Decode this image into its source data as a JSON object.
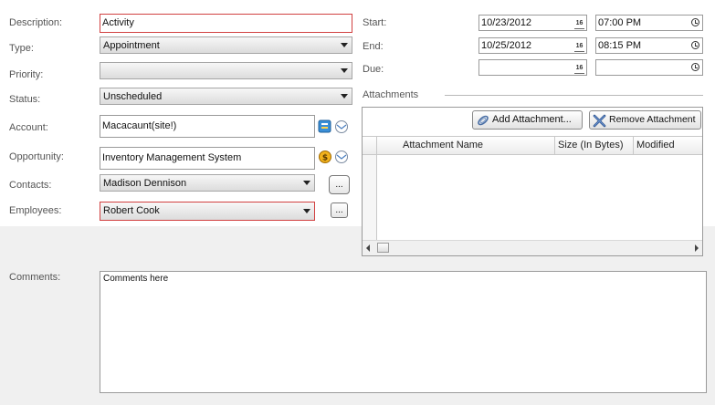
{
  "labels": {
    "description": "Description:",
    "type": "Type:",
    "priority": "Priority:",
    "status": "Status:",
    "account": "Account:",
    "opportunity": "Opportunity:",
    "contacts": "Contacts:",
    "employees": "Employees:",
    "comments": "Comments:",
    "start": "Start:",
    "end": "End:",
    "due": "Due:",
    "attachments": "Attachments"
  },
  "fields": {
    "description": "Activity",
    "type": "Appointment",
    "priority": "",
    "status": "Unscheduled",
    "account": "Macacaunt(site!)",
    "opportunity": "Inventory Management System",
    "contacts": "Madison Dennison",
    "employees": "Robert Cook",
    "comments": "Comments here"
  },
  "dates": {
    "start_date": "10/23/2012",
    "start_time": "07:00 PM",
    "end_date": "10/25/2012",
    "end_time": "08:15 PM",
    "due_date": "",
    "due_time": "",
    "calendar_glyph": "16"
  },
  "buttons": {
    "ellipsis": "...",
    "add_attachment": "Add Attachment...",
    "remove_attachment": "Remove Attachment"
  },
  "attachments_grid": {
    "columns": [
      "Attachment Name",
      "Size (In Bytes)",
      "Modified"
    ],
    "rows": []
  },
  "icons": {
    "account_lookup": "account-lookup-icon",
    "opportunity_lookup": "opportunity-lookup-icon",
    "email": "email-icon",
    "paperclip": "paperclip-icon",
    "remove": "remove-x-icon"
  },
  "colors": {
    "required_border": "#d14040",
    "panel_bg": "#f0f0f0"
  }
}
